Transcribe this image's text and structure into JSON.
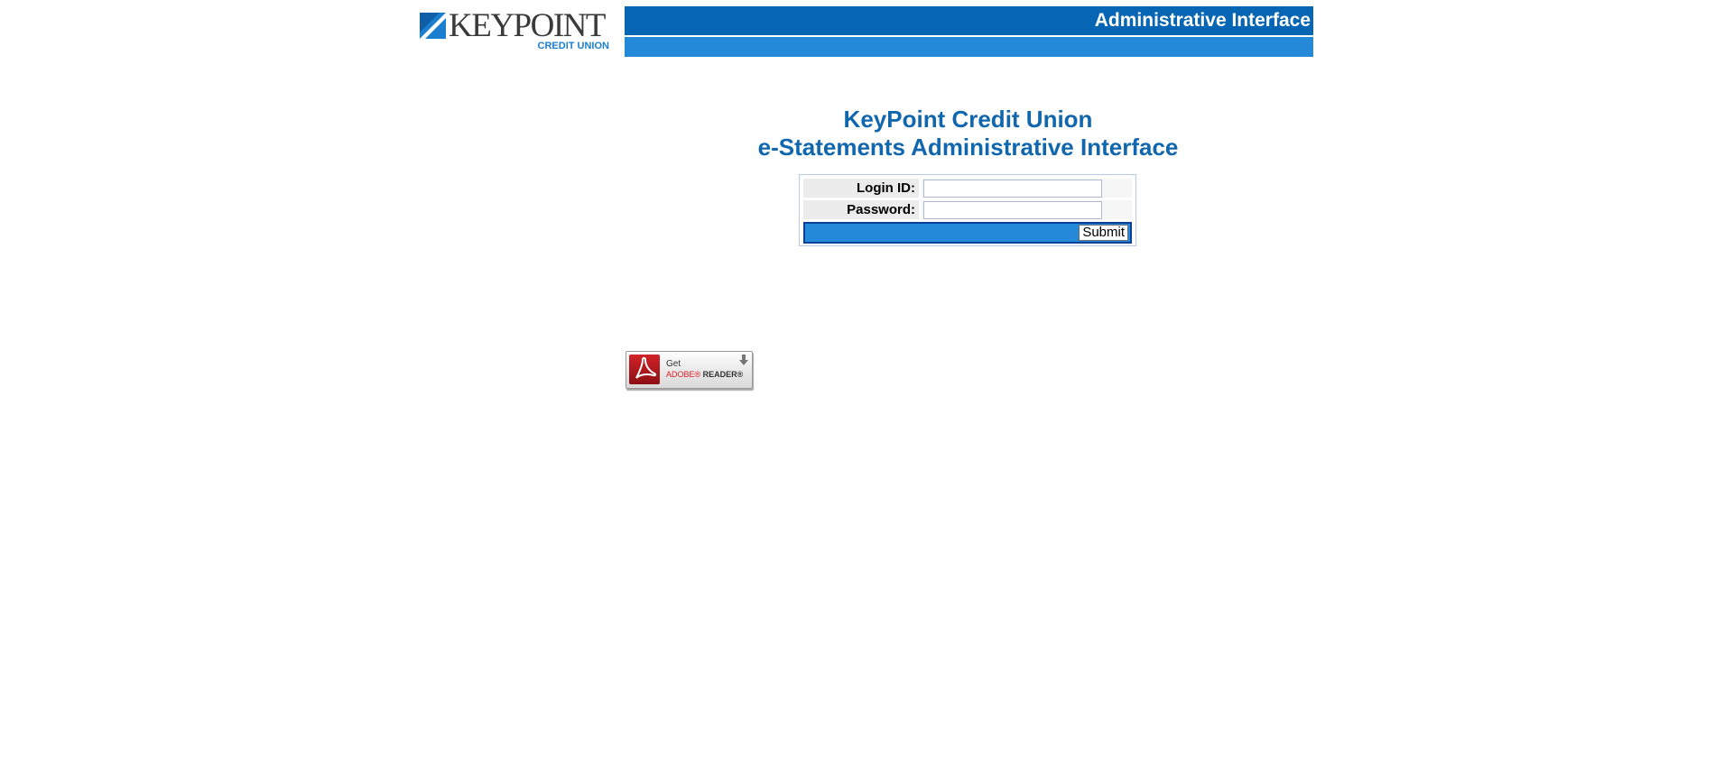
{
  "logo": {
    "wordmark": "KEYPOINT",
    "subtitle": "CREDIT UNION"
  },
  "header": {
    "title": "Administrative Interface"
  },
  "main": {
    "heading_line1": "KeyPoint Credit Union",
    "heading_line2": "e-Statements Administrative Interface"
  },
  "login_form": {
    "login_id_label": "Login ID:",
    "login_id_value": "",
    "password_label": "Password:",
    "password_value": "",
    "submit_label": "Submit"
  },
  "adobe_badge": {
    "get_text": "Get",
    "brand_text": "ADOBE®",
    "product_text": "READER®"
  },
  "colors": {
    "header_dark": "#0666b3",
    "header_light": "#2389d8",
    "heading_blue": "#1167ad",
    "submit_bar_border": "#0a3f99"
  }
}
